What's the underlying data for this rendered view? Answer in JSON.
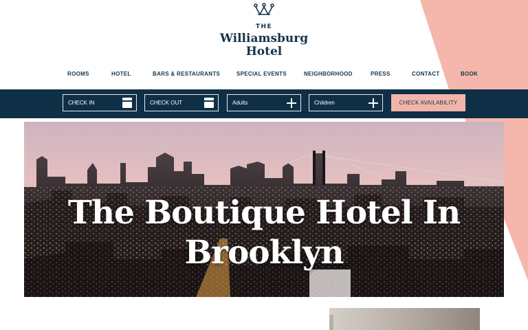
{
  "header": {
    "logo_icon": "crown-w-monogram-icon",
    "logo_line1": "THE",
    "logo_line2": "Williamsburg",
    "logo_line3": "Hotel"
  },
  "nav": {
    "items": [
      {
        "label": "ROOMS"
      },
      {
        "label": "HOTEL"
      },
      {
        "label": "BARS & RESTAURANTS"
      },
      {
        "label": "SPECIAL EVENTS"
      },
      {
        "label": "NEIGHBORHOOD"
      },
      {
        "label": "PRESS"
      },
      {
        "label": "CONTACT"
      },
      {
        "label": "BOOK"
      }
    ]
  },
  "booking": {
    "check_in": "CHECK IN",
    "check_out": "CHECK OUT",
    "adults": "Adults",
    "children": "Children",
    "submit": "CHECK AVAILABILITY"
  },
  "hero": {
    "title_line1": "The Boutique Hotel In",
    "title_line2": "Brooklyn"
  },
  "colors": {
    "navy": "#0f2f47",
    "text_navy": "#15344a",
    "pink": "#f5b7ab",
    "button_pink": "#f2b4a8"
  }
}
